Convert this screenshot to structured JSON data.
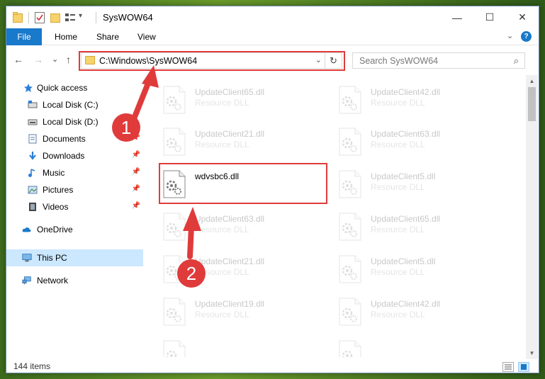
{
  "window": {
    "title": "SysWOW64",
    "controls": {
      "minimize": "—",
      "maximize": "☐",
      "close": "✕"
    }
  },
  "ribbon": {
    "file_tab": "File",
    "tabs": [
      "Home",
      "Share",
      "View"
    ],
    "help": "?"
  },
  "address": {
    "path": "C:\\Windows\\SysWOW64",
    "dropdown": "⌄",
    "refresh": "↻"
  },
  "search": {
    "placeholder": "Search SysWOW64",
    "icon": "⌕"
  },
  "nav": {
    "back": "←",
    "forward": "→",
    "recent": "⌄",
    "up": "↑"
  },
  "sidebar": {
    "items": [
      {
        "label": "Quick access",
        "icon": "star-icon",
        "pinned": false
      },
      {
        "label": "Local Disk (C:)",
        "icon": "drive-icon",
        "pinned": false
      },
      {
        "label": "Local Disk (D:)",
        "icon": "drive-icon",
        "pinned": false
      },
      {
        "label": "Documents",
        "icon": "documents-icon",
        "pinned": true
      },
      {
        "label": "Downloads",
        "icon": "download-icon",
        "pinned": true
      },
      {
        "label": "Music",
        "icon": "music-icon",
        "pinned": true
      },
      {
        "label": "Pictures",
        "icon": "pictures-icon",
        "pinned": true
      },
      {
        "label": "Videos",
        "icon": "videos-icon",
        "pinned": true
      },
      {
        "label": "OneDrive",
        "icon": "cloud-icon",
        "pinned": false
      },
      {
        "label": "This PC",
        "icon": "computer-icon",
        "pinned": false,
        "selected": true
      },
      {
        "label": "Network",
        "icon": "network-icon",
        "pinned": false
      }
    ]
  },
  "files": [
    {
      "name": "UpdateClient65.dll",
      "type": "Resource DLL"
    },
    {
      "name": "UpdateClient42.dll",
      "type": "Resource DLL"
    },
    {
      "name": "UpdateClient21.dll",
      "type": "Resource DLL"
    },
    {
      "name": "UpdateClient63.dll",
      "type": "Resource DLL"
    },
    {
      "name": "wdvsbc6.dll",
      "type": "",
      "highlighted": true
    },
    {
      "name": "UpdateClient5.dll",
      "type": "Resource DLL"
    },
    {
      "name": "UpdateClient63.dll",
      "type": "Resource DLL"
    },
    {
      "name": "UpdateClient65.dll",
      "type": "Resource DLL"
    },
    {
      "name": "UpdateClient21.dll",
      "type": "Resource DLL"
    },
    {
      "name": "UpdateClient5.dll",
      "type": "Resource DLL"
    },
    {
      "name": "UpdateClient19.dll",
      "type": "Resource DLL"
    },
    {
      "name": "UpdateClient42.dll",
      "type": "Resource DLL"
    },
    {
      "name": "",
      "type": ""
    },
    {
      "name": "",
      "type": ""
    }
  ],
  "status": {
    "count": "144 items"
  },
  "annotations": {
    "step1": "1",
    "step2": "2",
    "color": "#e03b3b"
  },
  "colors": {
    "accent": "#1979ca",
    "selected": "#cce8ff",
    "folder": "#f6d36b"
  }
}
